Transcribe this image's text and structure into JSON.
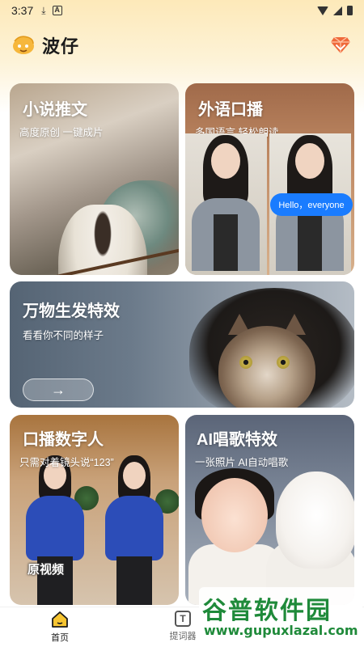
{
  "status_bar": {
    "time": "3:37",
    "download_icon": "download-icon",
    "notification_icon": "a-box-icon"
  },
  "header": {
    "title": "波仔",
    "logo_icon": "mascot-face-icon",
    "gem_icon": "diamond-gem-icon"
  },
  "cards": {
    "novel": {
      "title": "小说推文",
      "subtitle": "高度原创 一键成片"
    },
    "language": {
      "title": "外语口播",
      "subtitle": "多国语言 轻松朗读",
      "bubble": "Hello，everyone"
    },
    "hair": {
      "title": "万物生发特效",
      "subtitle": "看看你不同的样子",
      "button": "→"
    },
    "human": {
      "title": "口播数字人",
      "subtitle": "只需对着镜头说“123”",
      "badge": "原视频"
    },
    "sing": {
      "title": "AI唱歌特效",
      "subtitle": "一张照片 AI自动唱歌"
    }
  },
  "watermark": {
    "cn": "谷普软件园",
    "url": "www.gupuxlazal.com"
  },
  "bottom_nav": {
    "items": [
      {
        "label": "首页",
        "icon": "home-icon",
        "active": true
      },
      {
        "label": "提词器",
        "icon": "teleprompter-icon",
        "active": false
      }
    ]
  },
  "colors": {
    "accent": "#f5a623",
    "bubble": "#1a7cff",
    "active_label": "#1a1a1a",
    "watermark_green": "#1f8a3a"
  }
}
